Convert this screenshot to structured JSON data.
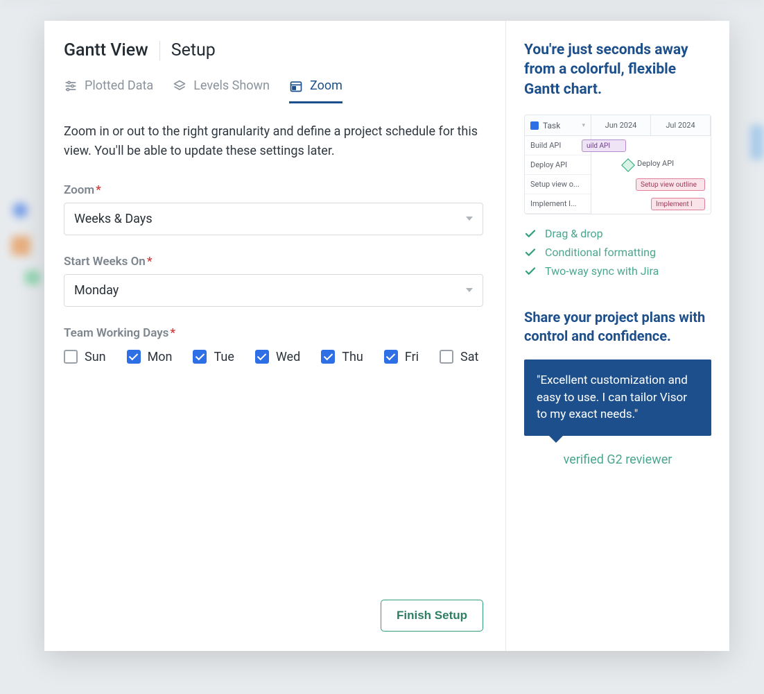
{
  "header": {
    "title": "Gantt View",
    "subtitle": "Setup"
  },
  "tabs": {
    "plotted_data": "Plotted Data",
    "levels_shown": "Levels Shown",
    "zoom": "Zoom"
  },
  "description": "Zoom in or out to the right granularity and define a project schedule for this view. You'll be able to update these settings later.",
  "fields": {
    "zoom": {
      "label": "Zoom",
      "value": "Weeks & Days"
    },
    "start_weeks_on": {
      "label": "Start Weeks On",
      "value": "Monday"
    },
    "working_days": {
      "label": "Team Working Days",
      "days": [
        {
          "label": "Sun",
          "checked": false
        },
        {
          "label": "Mon",
          "checked": true
        },
        {
          "label": "Tue",
          "checked": true
        },
        {
          "label": "Wed",
          "checked": true
        },
        {
          "label": "Thu",
          "checked": true
        },
        {
          "label": "Fri",
          "checked": true
        },
        {
          "label": "Sat",
          "checked": false
        }
      ]
    }
  },
  "footer": {
    "finish": "Finish Setup"
  },
  "side": {
    "heading1": "You're just seconds away from a colorful, flexible Gantt chart.",
    "preview": {
      "task_header": "Task",
      "months": [
        "Jun 2024",
        "Jul 2024"
      ],
      "rows": [
        "Build API",
        "Deploy API",
        "Setup view o...",
        "Implement l..."
      ],
      "bar_build": "uild API",
      "bar_deploy": "Deploy API",
      "bar_setup": "Setup view outline",
      "bar_implement": "Implement l"
    },
    "features": [
      "Drag & drop",
      "Conditional formatting",
      "Two-way sync with Jira"
    ],
    "heading2": "Share your project plans with control and confidence.",
    "quote": "\"Excellent customization and easy to use. I can tailor Visor to my exact needs.\"",
    "reviewer": "verified G2 reviewer"
  }
}
